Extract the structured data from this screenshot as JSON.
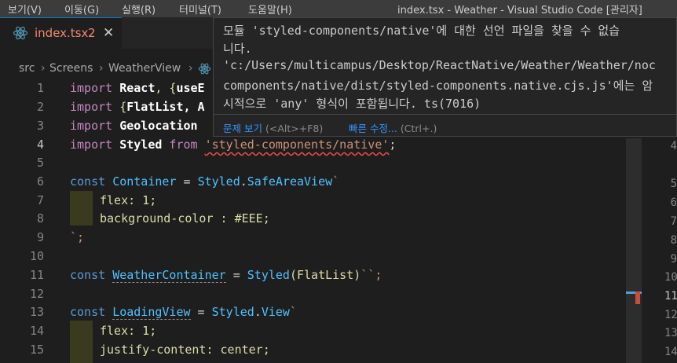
{
  "menubar": {
    "items": [
      "보기(V)",
      "이동(G)",
      "실행(R)",
      "터미널(T)",
      "도움말(H)"
    ],
    "window_title": "index.tsx - Weather - Visual Studio Code [관리자]"
  },
  "tab": {
    "label": "index.tsx",
    "problem_count": "2",
    "close_glyph": "✕",
    "icon": "react-icon"
  },
  "breadcrumb": [
    "src",
    "Screens",
    "WeatherView"
  ],
  "editor": {
    "line_numbers": [
      "1",
      "2",
      "3",
      "4",
      "5",
      "6",
      "7",
      "8",
      "9",
      "10",
      "11",
      "12",
      "13",
      "14",
      "15"
    ],
    "lines": {
      "l1": [
        "import ",
        "React",
        ", {",
        "useE"
      ],
      "l2": [
        "import ",
        "{",
        "FlatList",
        ", A"
      ],
      "l3": [
        "import ",
        "Geolocation"
      ],
      "l4": [
        "import ",
        "Styled",
        " from ",
        "'styled-components/native'",
        ";"
      ],
      "l6": [
        "const ",
        "Container",
        " = ",
        "Styled",
        ".",
        "SafeAreaView",
        "`"
      ],
      "l7": [
        "flex: 1;"
      ],
      "l8": [
        "background-color : #EEE;"
      ],
      "l9": [
        "`;"
      ],
      "l11": [
        "const ",
        "WeatherContainer",
        " = ",
        "Styled",
        "(",
        "FlatList",
        ")",
        "``;"
      ],
      "l13": [
        "const ",
        "LoadingView",
        " = ",
        "Styled",
        ".",
        "View",
        "`"
      ],
      "l14": [
        "flex: 1;"
      ],
      "l15": [
        "justify-content: center;"
      ]
    },
    "minimap_numbers": [
      "4",
      "5",
      "6",
      "7",
      "8",
      "9",
      "10",
      "11",
      "12",
      "13",
      "14"
    ]
  },
  "hover": {
    "line1": "모듈 'styled-components/native'에 대한 선언 파일을 찾을 수 없습",
    "line2": "니다.",
    "line3": "'c:/Users/multicampus/Desktop/ReactNative/Weather/Weather/noc",
    "line4": "components/native/dist/styled-components.native.cjs.js'에는 암",
    "line5": "시적으로 'any' 형식이 포함됩니다. ts(7016)",
    "action_view_problem": "문제 보기",
    "action_view_problem_shortcut": "(<Alt>+F8)",
    "action_quick_fix": "빠른 수정...",
    "action_quick_fix_shortcut": "(Ctrl+.)"
  },
  "colors": {
    "accent": "#007acc",
    "error": "#f14c4c",
    "link": "#3794ff"
  }
}
